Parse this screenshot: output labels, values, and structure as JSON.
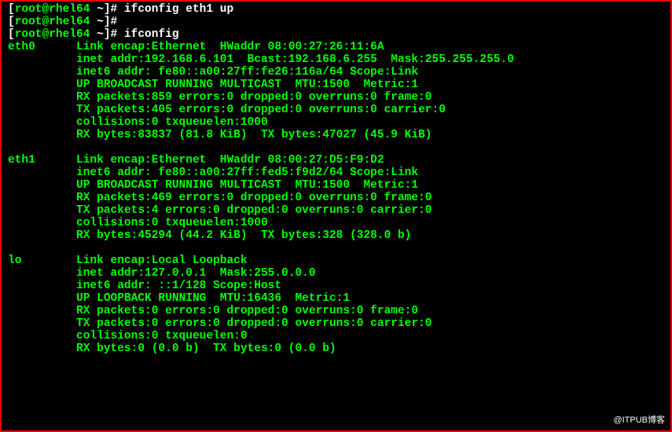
{
  "prompt": {
    "open": "[",
    "close": "]#",
    "user_host": "root@rhel64",
    "cwd": "~"
  },
  "cmds": {
    "c0": " ifconfig eth1 up",
    "c1": " ",
    "c2": " ifconfig"
  },
  "out": {
    "e0l0": "eth0      Link encap:Ethernet  HWaddr 08:00:27:26:11:6A",
    "e0l1": "          inet addr:192.168.6.101  Bcast:192.168.6.255  Mask:255.255.255.0",
    "e0l2": "          inet6 addr: fe80::a00:27ff:fe26:116a/64 Scope:Link",
    "e0l3": "          UP BROADCAST RUNNING MULTICAST  MTU:1500  Metric:1",
    "e0l4": "          RX packets:859 errors:0 dropped:0 overruns:0 frame:0",
    "e0l5": "          TX packets:405 errors:0 dropped:0 overruns:0 carrier:0",
    "e0l6": "          collisions:0 txqueuelen:1000",
    "e0l7": "          RX bytes:83837 (81.8 KiB)  TX bytes:47027 (45.9 KiB)",
    "blank1": " ",
    "e1l0": "eth1      Link encap:Ethernet  HWaddr 08:00:27:D5:F9:D2",
    "e1l1": "          inet6 addr: fe80::a00:27ff:fed5:f9d2/64 Scope:Link",
    "e1l2": "          UP BROADCAST RUNNING MULTICAST  MTU:1500  Metric:1",
    "e1l3": "          RX packets:469 errors:0 dropped:0 overruns:0 frame:0",
    "e1l4": "          TX packets:4 errors:0 dropped:0 overruns:0 carrier:0",
    "e1l5": "          collisions:0 txqueuelen:1000",
    "e1l6": "          RX bytes:45294 (44.2 KiB)  TX bytes:328 (328.0 b)",
    "blank2": " ",
    "lol0": "lo        Link encap:Local Loopback",
    "lol1": "          inet addr:127.0.0.1  Mask:255.0.0.0",
    "lol2": "          inet6 addr: ::1/128 Scope:Host",
    "lol3": "          UP LOOPBACK RUNNING  MTU:16436  Metric:1",
    "lol4": "          RX packets:0 errors:0 dropped:0 overruns:0 frame:0",
    "lol5": "          TX packets:0 errors:0 dropped:0 overruns:0 carrier:0",
    "lol6": "          collisions:0 txqueuelen:0",
    "lol7": "          RX bytes:0 (0.0 b)  TX bytes:0 (0.0 b)"
  },
  "watermark": "@ITPUB博客"
}
